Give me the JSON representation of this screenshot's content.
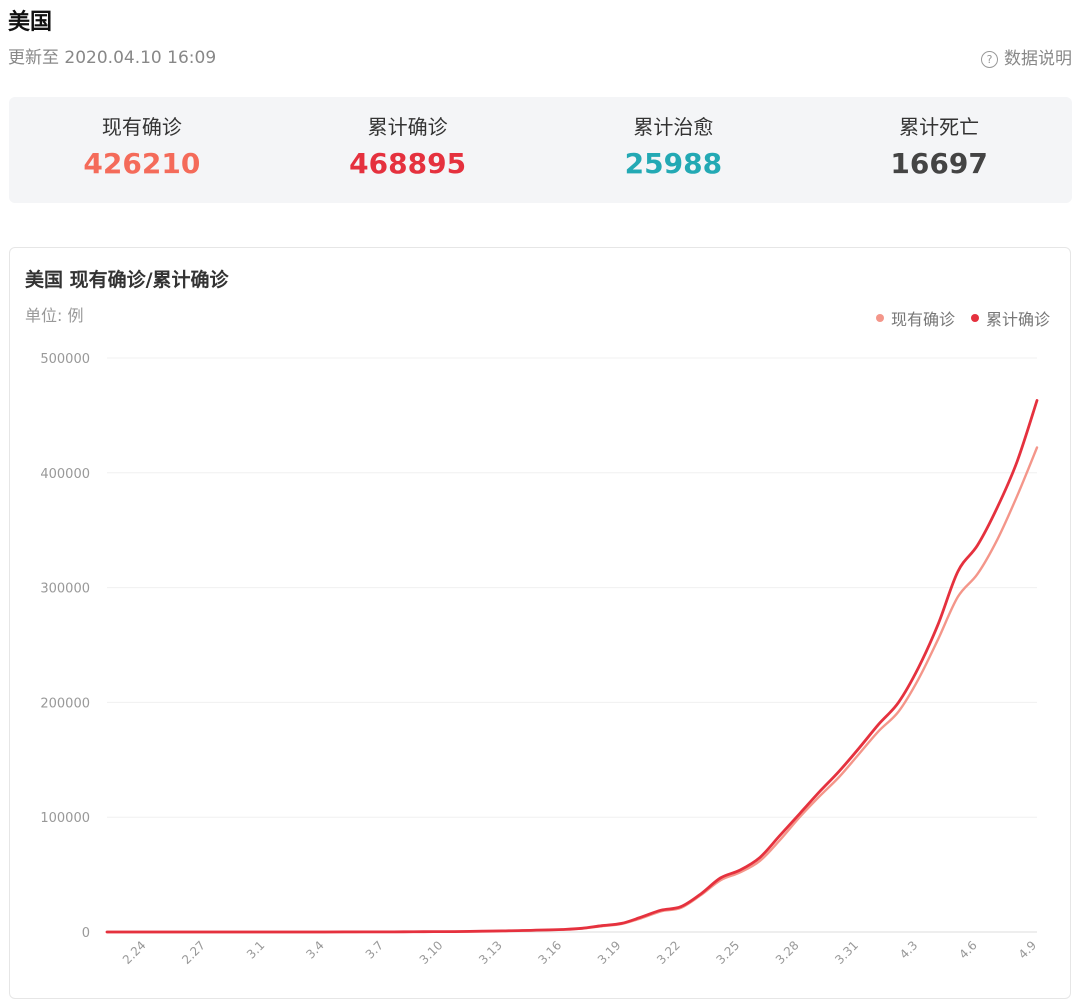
{
  "header": {
    "title": "美国",
    "update_time": "更新至 2020.04.10 16:09",
    "help_label": "数据说明",
    "help_icon": "question-circle-icon"
  },
  "stats": [
    {
      "label": "现有确诊",
      "value": "426210",
      "color": "#f46b5a"
    },
    {
      "label": "累计确诊",
      "value": "468895",
      "color": "#e5313e"
    },
    {
      "label": "累计治愈",
      "value": "25988",
      "color": "#23a9b4"
    },
    {
      "label": "累计死亡",
      "value": "16697",
      "color": "#444444"
    }
  ],
  "chart_data": {
    "type": "line",
    "title": "美国 现有确诊/累计确诊",
    "unit": "单位: 例",
    "ylim": [
      0,
      500000
    ],
    "y_ticks": [
      0,
      100000,
      200000,
      300000,
      400000,
      500000
    ],
    "y_tick_labels": [
      "0",
      "100000",
      "200000",
      "300000",
      "400000",
      "500000"
    ],
    "x_tick_labels": [
      "2.24",
      "2.27",
      "3.1",
      "3.4",
      "3.7",
      "3.10",
      "3.13",
      "3.16",
      "3.19",
      "3.22",
      "3.25",
      "3.28",
      "3.31",
      "4.3",
      "4.6",
      "4.9"
    ],
    "x_tick_index": [
      2,
      5,
      8,
      11,
      14,
      17,
      20,
      23,
      26,
      29,
      32,
      35,
      38,
      41,
      44,
      47
    ],
    "x_points": 48,
    "legend_position": "top-right",
    "grid": true,
    "series": [
      {
        "name": "现有确诊",
        "color": "#f4968a",
        "values": [
          15,
          15,
          15,
          15,
          15,
          15,
          15,
          15,
          15,
          20,
          25,
          30,
          35,
          50,
          80,
          150,
          200,
          300,
          400,
          650,
          900,
          1200,
          1600,
          2000,
          3000,
          5000,
          7000,
          12000,
          18000,
          21000,
          32000,
          45000,
          52000,
          62000,
          80000,
          100000,
          118000,
          135000,
          155000,
          175000,
          192000,
          220000,
          255000,
          292000,
          312000,
          342000,
          380000,
          422000
        ]
      },
      {
        "name": "累计确诊",
        "color": "#e5313e",
        "values": [
          15,
          15,
          15,
          15,
          15,
          15,
          15,
          15,
          20,
          30,
          35,
          40,
          50,
          70,
          100,
          180,
          250,
          350,
          450,
          700,
          1000,
          1300,
          1700,
          2200,
          3200,
          5500,
          7500,
          13000,
          19000,
          22000,
          33000,
          47000,
          54000,
          65000,
          84000,
          103000,
          122000,
          140000,
          160000,
          181000,
          200000,
          230000,
          268000,
          314000,
          337000,
          370000,
          410000,
          463000
        ]
      }
    ]
  }
}
